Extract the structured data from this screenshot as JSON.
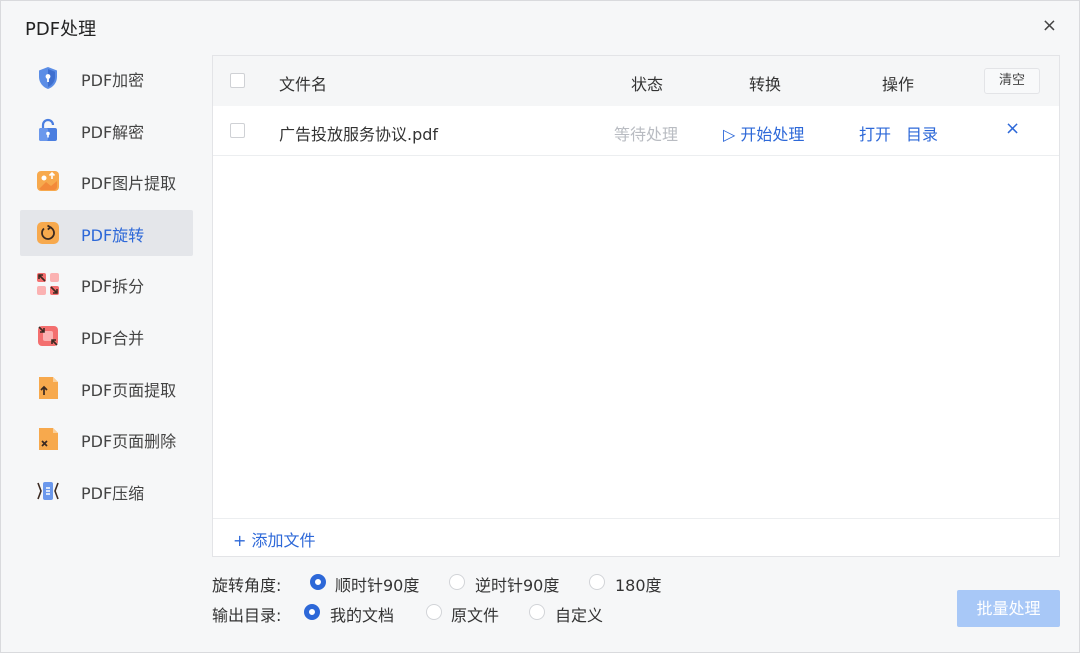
{
  "window": {
    "title": "PDF处理",
    "close": "×"
  },
  "sidebar": {
    "items": [
      {
        "label": "PDF加密",
        "icon": "shield-lock-icon"
      },
      {
        "label": "PDF解密",
        "icon": "unlock-icon"
      },
      {
        "label": "PDF图片提取",
        "icon": "image-extract-icon"
      },
      {
        "label": "PDF旋转",
        "icon": "rotate-icon",
        "active": true
      },
      {
        "label": "PDF拆分",
        "icon": "split-icon"
      },
      {
        "label": "PDF合并",
        "icon": "merge-icon"
      },
      {
        "label": "PDF页面提取",
        "icon": "page-extract-icon"
      },
      {
        "label": "PDF页面删除",
        "icon": "page-delete-icon"
      },
      {
        "label": "PDF压缩",
        "icon": "compress-icon"
      }
    ]
  },
  "table": {
    "headers": {
      "name": "文件名",
      "status": "状态",
      "convert": "转换",
      "actions": "操作",
      "clear": "清空"
    },
    "rows": [
      {
        "name": "广告投放服务协议.pdf",
        "status": "等待处理",
        "start": "▷ 开始处理",
        "open": "打开",
        "dir": "目录",
        "delete": "×"
      }
    ],
    "add_file": "+  添加文件"
  },
  "options": {
    "rotate": {
      "label": "旋转角度:",
      "choices": [
        "顺时针90度",
        "逆时针90度",
        "180度"
      ],
      "selected": "顺时针90度"
    },
    "output": {
      "label": "输出目录:",
      "choices": [
        "我的文档",
        "原文件",
        "自定义"
      ],
      "selected": "我的文档"
    }
  },
  "batch_button": "批量处理",
  "colors": {
    "accent": "#2d68d8",
    "disabled_button": "#a8c8f7",
    "pending_status": "#b9bcc2"
  }
}
